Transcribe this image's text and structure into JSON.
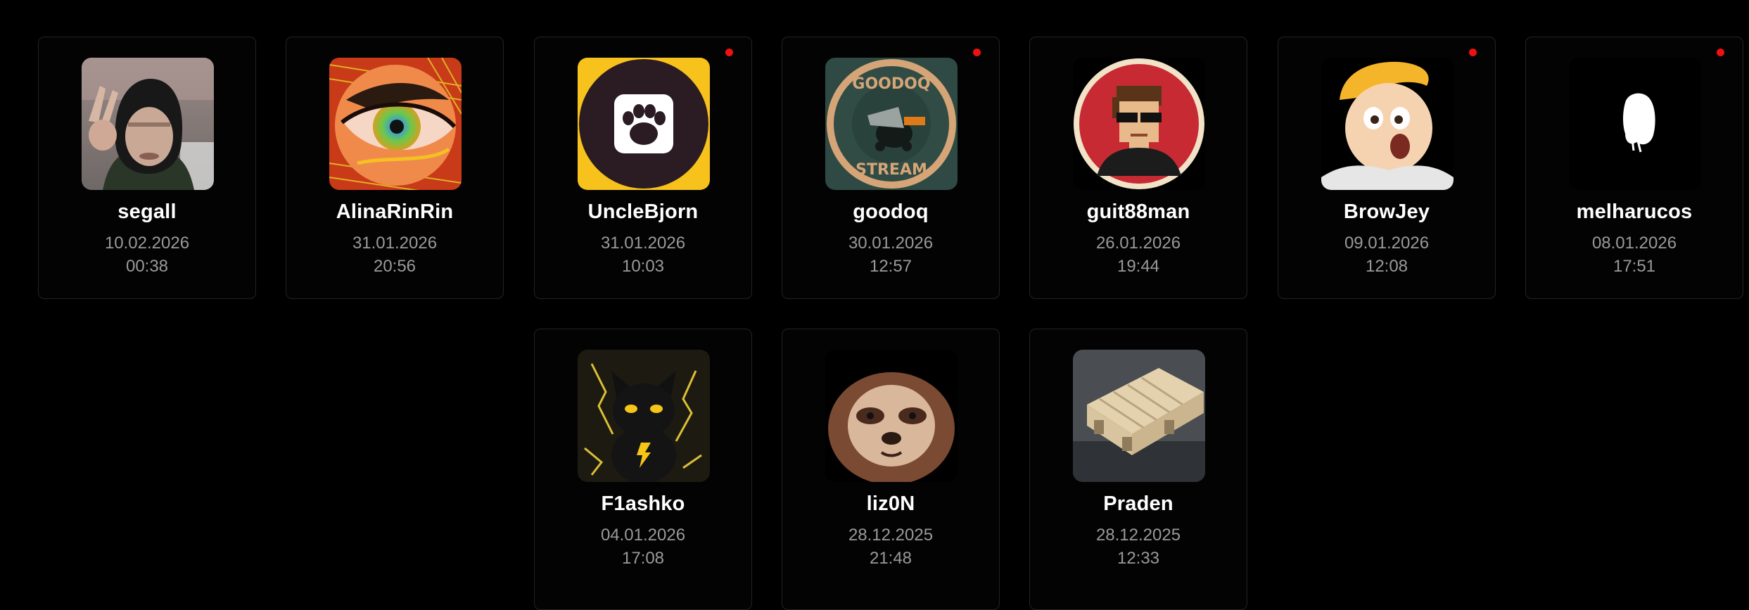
{
  "channels": [
    {
      "username": "segall",
      "date": "10.02.2026",
      "time": "00:38",
      "live": false,
      "avatar_icon": "person-hooded-photo"
    },
    {
      "username": "AlinaRinRin",
      "date": "31.01.2026",
      "time": "20:56",
      "live": false,
      "avatar_icon": "eye-art"
    },
    {
      "username": "UncleBjorn",
      "date": "31.01.2026",
      "time": "10:03",
      "live": true,
      "avatar_icon": "paw-icon"
    },
    {
      "username": "goodoq",
      "date": "30.01.2026",
      "time": "12:57",
      "live": true,
      "avatar_icon": "goodoq-stream-badge",
      "avatar_text_top": "GOODOQ",
      "avatar_text_bottom": "STREAM"
    },
    {
      "username": "guit88man",
      "date": "26.01.2026",
      "time": "19:44",
      "live": false,
      "avatar_icon": "pixel-man-sunglasses"
    },
    {
      "username": "BrowJey",
      "date": "09.01.2026",
      "time": "12:08",
      "live": true,
      "avatar_icon": "cartoon-surprised-face"
    },
    {
      "username": "melharucos",
      "date": "08.01.2026",
      "time": "17:51",
      "live": true,
      "avatar_icon": "ghost-silhouette"
    },
    {
      "username": "F1ashko",
      "date": "04.01.2026",
      "time": "17:08",
      "live": false,
      "avatar_icon": "black-cat-lightning"
    },
    {
      "username": "liz0N",
      "date": "28.12.2025",
      "time": "21:48",
      "live": false,
      "avatar_icon": "pixel-sloth"
    },
    {
      "username": "Praden",
      "date": "28.12.2025",
      "time": "12:33",
      "live": false,
      "avatar_icon": "wooden-pallet-photo"
    }
  ],
  "colors": {
    "background": "#000000",
    "card_border": "#232323",
    "name": "#ffffff",
    "meta": "#9a9a9a",
    "live_indicator": "#ee1111"
  }
}
